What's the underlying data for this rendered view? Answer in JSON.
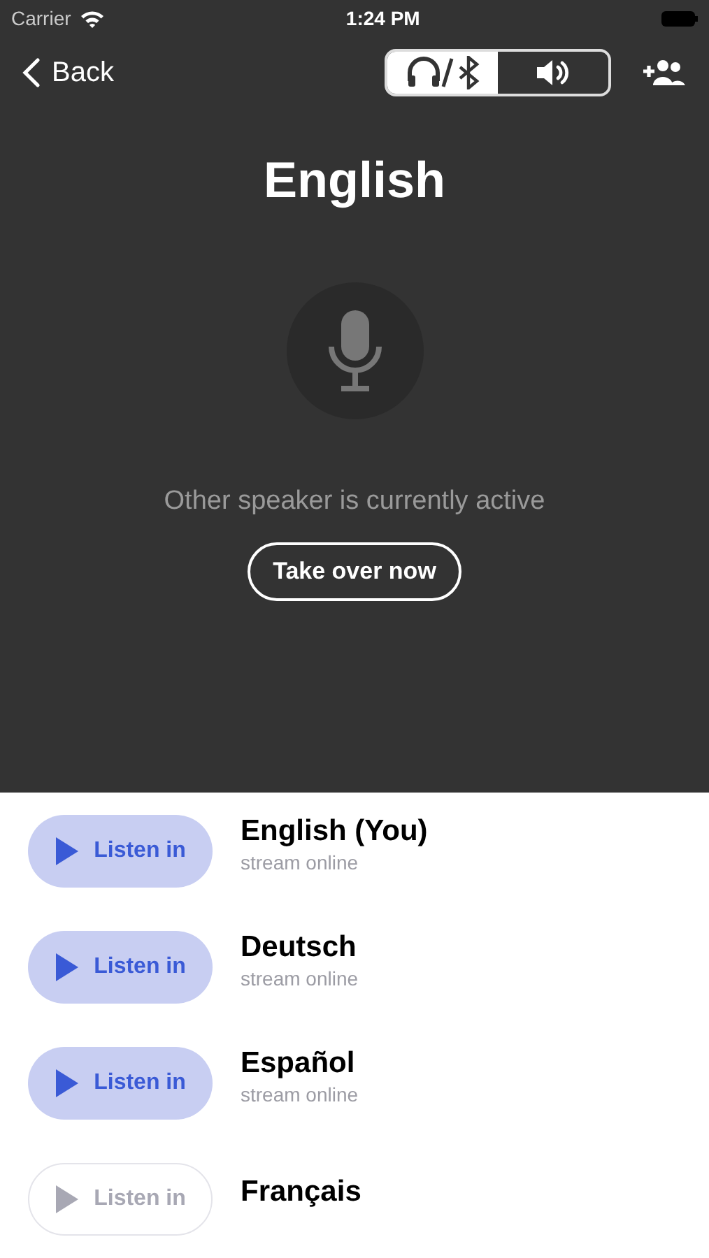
{
  "status_bar": {
    "carrier": "Carrier",
    "time": "1:24 PM"
  },
  "nav": {
    "back": "Back",
    "outputs": [
      {
        "kind": "headphones",
        "selected": true
      },
      {
        "kind": "speaker",
        "selected": false
      }
    ]
  },
  "title": "English",
  "mic": {
    "active": false
  },
  "message": "Other speaker is currently active",
  "take_over": "Take over now",
  "channels": [
    {
      "name": "English (You)",
      "status": "stream online",
      "button": "Listen in",
      "online": true
    },
    {
      "name": "Deutsch",
      "status": "stream online",
      "button": "Listen in",
      "online": true
    },
    {
      "name": "Español",
      "status": "stream online",
      "button": "Listen in",
      "online": true
    },
    {
      "name": "Français",
      "button": "Listen in",
      "online": false
    }
  ]
}
